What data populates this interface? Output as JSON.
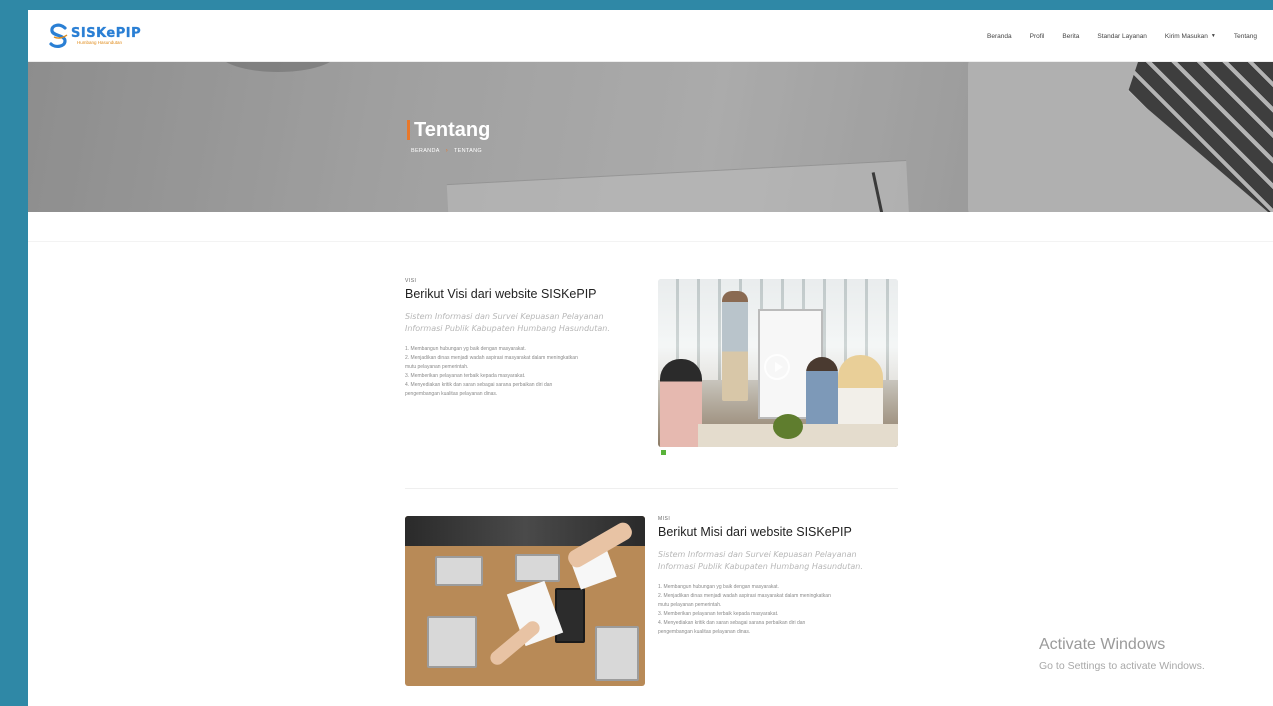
{
  "brand": {
    "logo_name": "SISKePIP",
    "logo_sub": "Humbang Hasundutan"
  },
  "nav": {
    "items": [
      {
        "label": "Beranda"
      },
      {
        "label": "Profil"
      },
      {
        "label": "Berita"
      },
      {
        "label": "Standar Layanan"
      },
      {
        "label": "Kirim Masukan",
        "has_dropdown": true
      },
      {
        "label": "Tentang"
      }
    ]
  },
  "hero": {
    "title": "Tentang",
    "breadcrumb": [
      "BERANDA",
      "TENTANG"
    ]
  },
  "visi": {
    "kicker": "VISI",
    "title": "Berikut Visi dari website SISKePIP",
    "lead": "Sistem Informasi dan Survei Kepuasan Pelayanan Informasi Publik Kabupaten Humbang Hasundutan.",
    "lines": [
      "1. Membangun hubungan yg baik dengan masyarakat.",
      "2. Menjadikan dinas menjadi wadah aspirasi masyarakat dalam meningkatkan",
      "mutu pelayanan pemerintah.",
      "3. Memberikan pelayanan terbaik kepada masyarakat.",
      "4. Menyediakan kritik dan saran sebagai sarana perbaikan diri dan",
      "pengembangan kualitas pelayanan dinas."
    ]
  },
  "misi": {
    "kicker": "MISI",
    "title": "Berikut Misi dari website SISKePIP",
    "lead": "Sistem Informasi dan Survei Kepuasan Pelayanan Informasi Publik Kabupaten Humbang Hasundutan.",
    "lines": [
      "1. Membangun hubungan yg baik dengan masyarakat.",
      "2. Menjadikan dinas menjadi wadah aspirasi masyarakat dalam meningkatkan",
      "mutu pelayanan pemerintah.",
      "3. Memberikan pelayanan terbaik kepada masyarakat.",
      "4. Menyediakan kritik dan saran sebagai sarana perbaikan diri dan",
      "pengembangan kualitas pelayanan dinas."
    ]
  },
  "watermark": {
    "title": "Activate Windows",
    "subtitle": "Go to Settings to activate Windows."
  },
  "colors": {
    "frame": "#2f88a6",
    "accent": "#e8782b",
    "brand_blue": "#2a7fd4"
  }
}
